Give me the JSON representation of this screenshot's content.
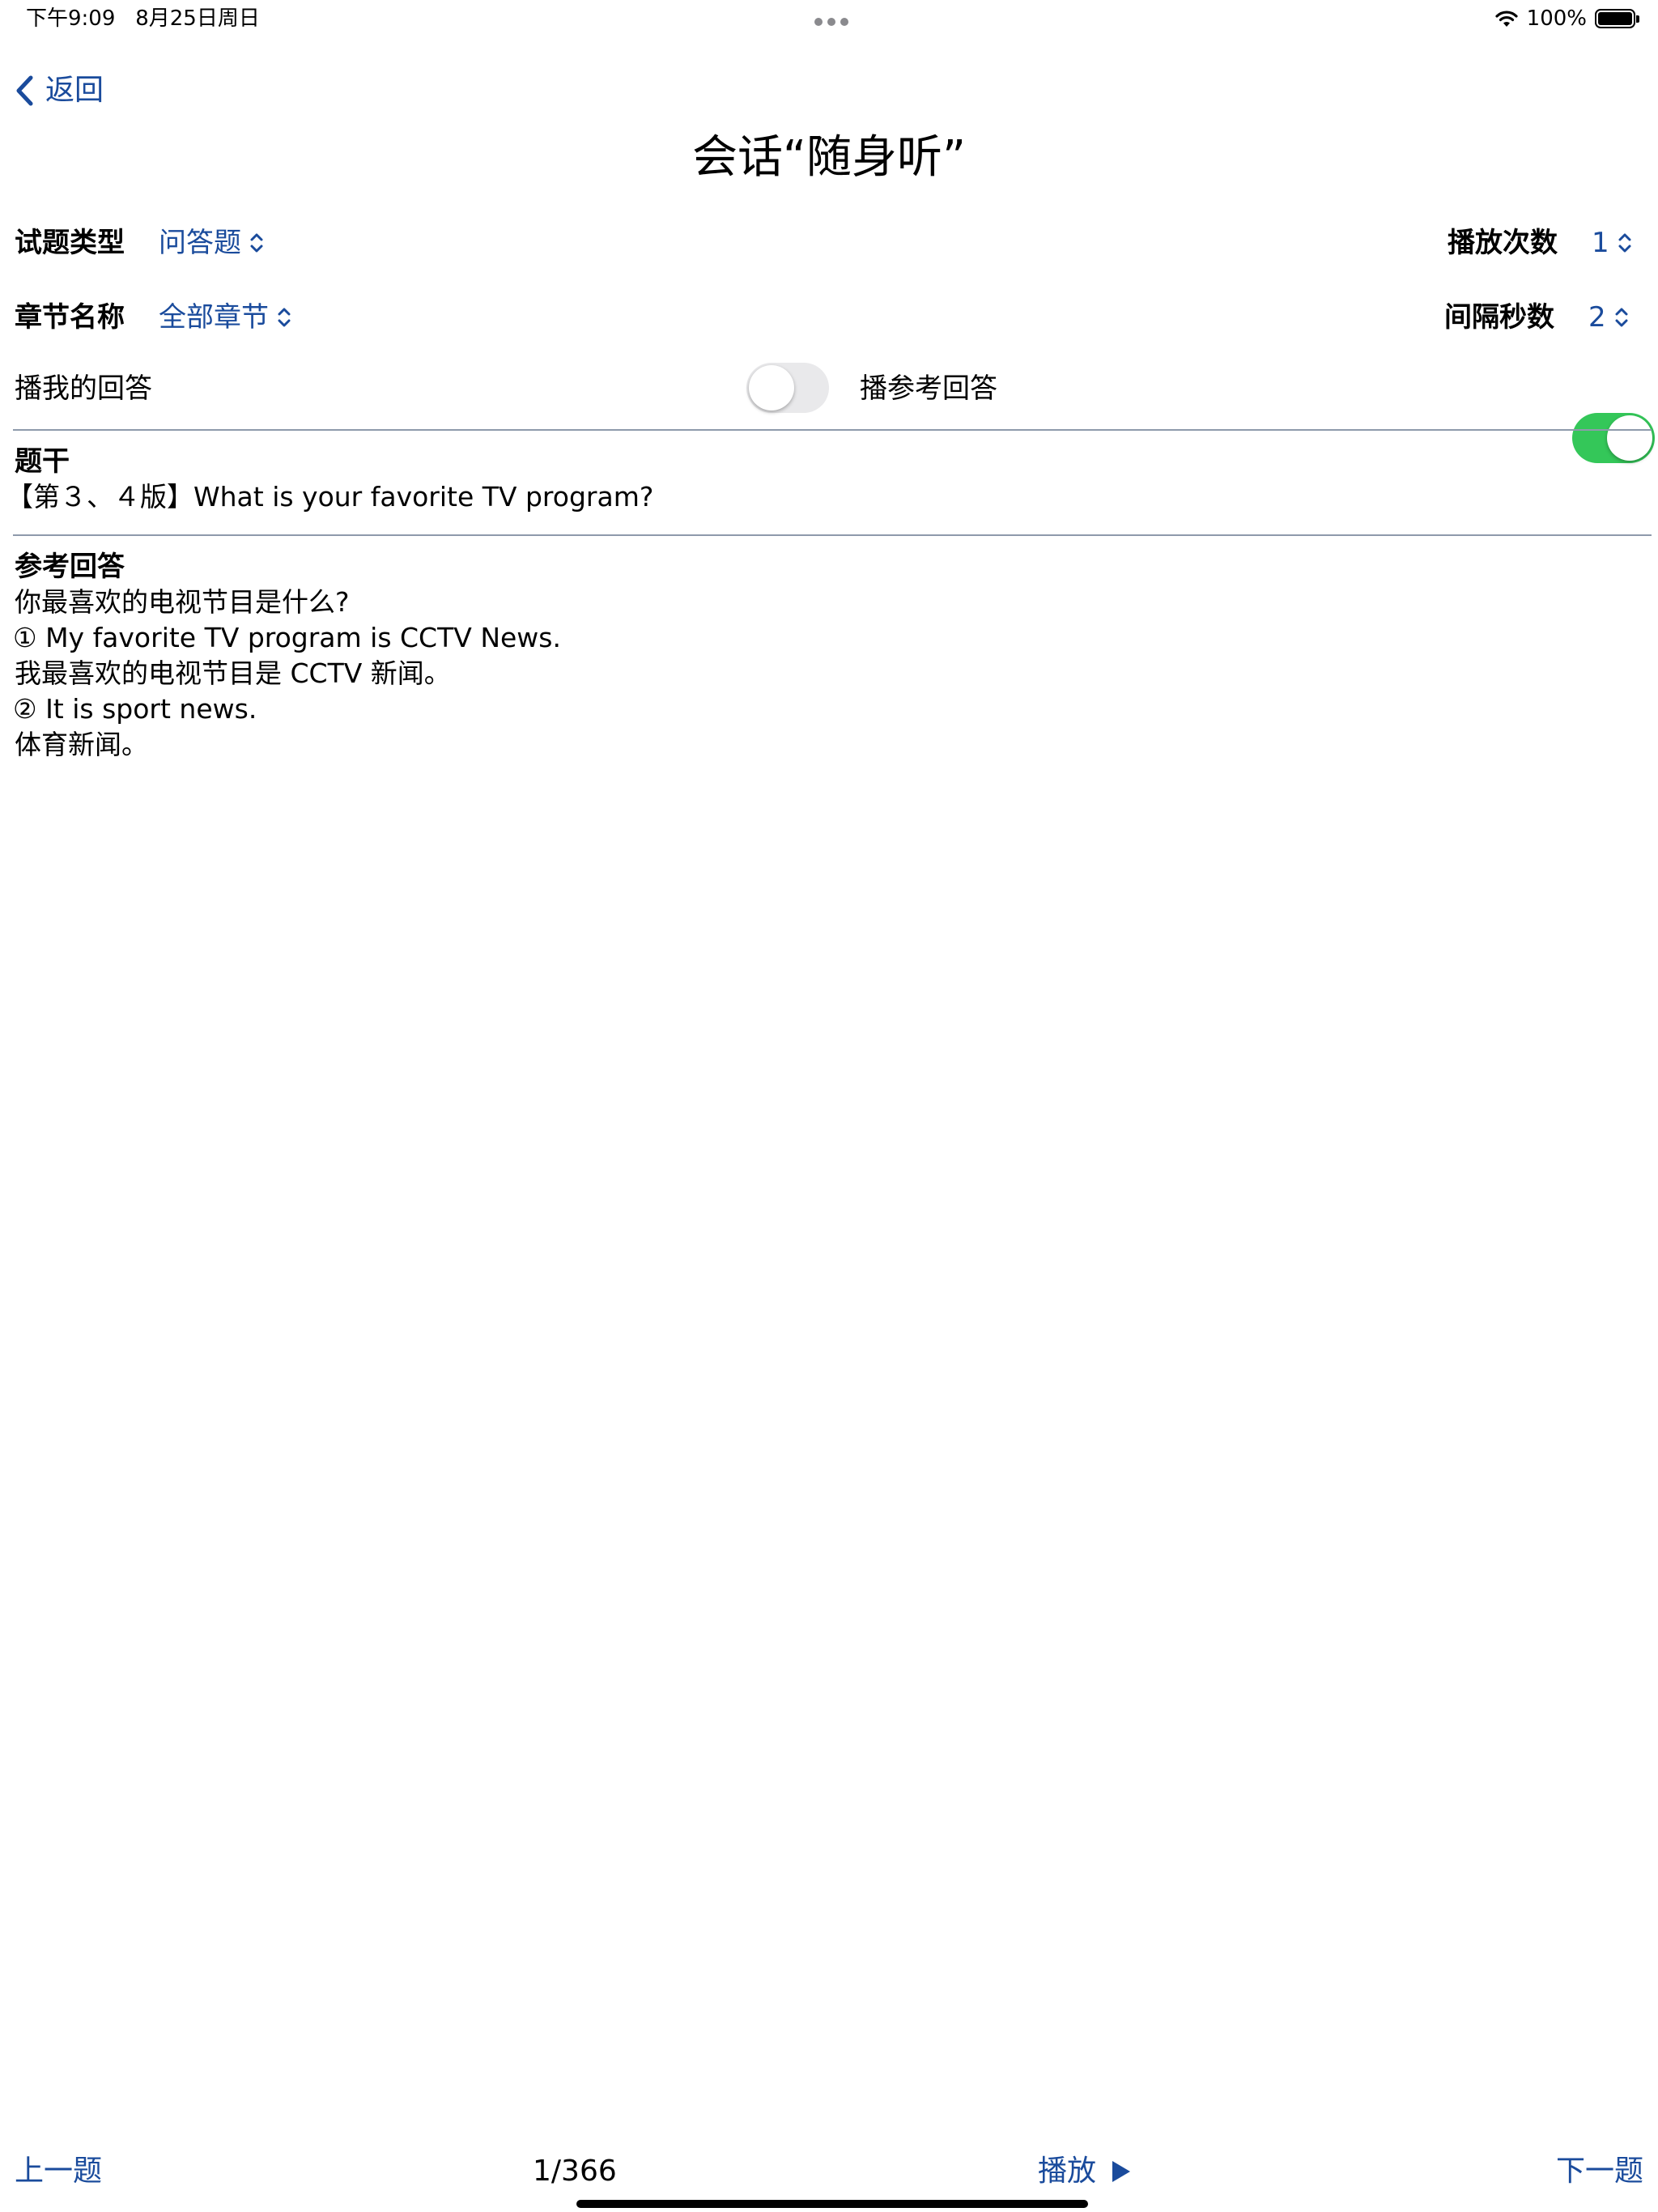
{
  "status_bar": {
    "time": "下午9:09",
    "date": "8月25日周日",
    "battery": "100%"
  },
  "nav": {
    "back_label": "返回",
    "title": "会话“随身听”"
  },
  "settings": {
    "question_type_label": "试题类型",
    "question_type_value": "问答题",
    "play_count_label": "播放次数",
    "play_count_value": "1",
    "chapter_label": "章节名称",
    "chapter_value": "全部章节",
    "interval_label": "间隔秒数",
    "interval_value": "2",
    "play_my_answer_label": "播我的回答",
    "play_my_answer_on": false,
    "play_reference_label": "播参考回答",
    "play_reference_on": true
  },
  "question": {
    "heading": "题干",
    "text": "【第３、４版】What is your favorite TV program?"
  },
  "answer": {
    "heading": "参考回答",
    "lines": [
      "你最喜欢的电视节目是什么?",
      "① My favorite TV program is CCTV News.",
      "我最喜欢的电视节目是 CCTV 新闻。",
      "② It is sport news.",
      "体育新闻。"
    ]
  },
  "bottom_bar": {
    "prev_label": "上一题",
    "page": "1/366",
    "play_label": "播放",
    "next_label": "下一题"
  },
  "colors": {
    "accent": "#1a4b9c",
    "toggle_on": "#34c759",
    "toggle_off": "#e9e9eb"
  }
}
